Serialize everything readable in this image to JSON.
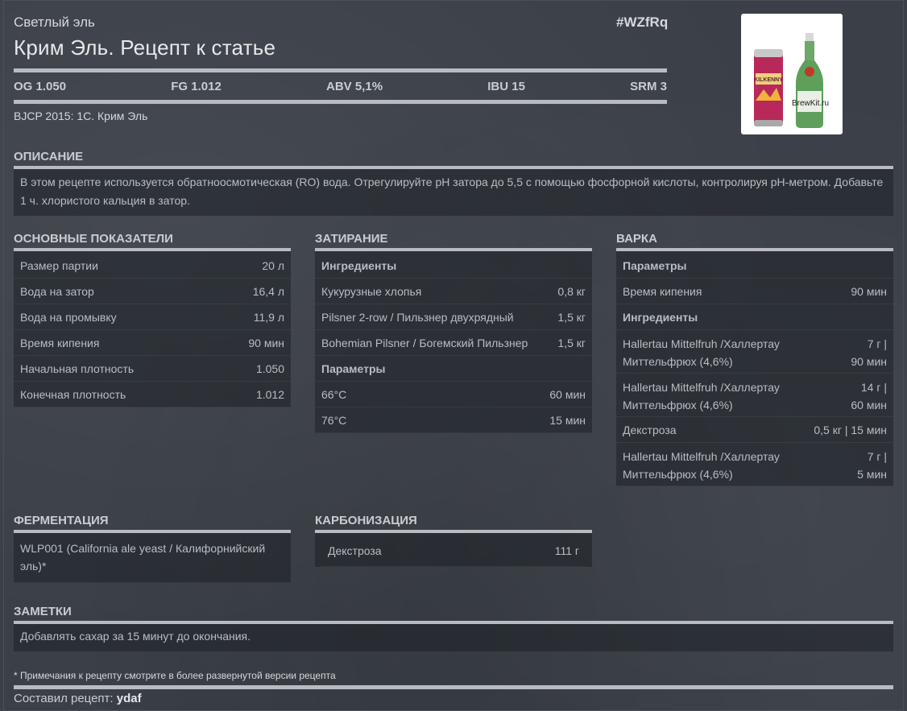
{
  "header": {
    "style_name": "Светлый эль",
    "title": "Крим Эль. Рецепт к статье",
    "code": "#WZfRq",
    "image_watermark": "BrewKit.ru",
    "image_can_text": "KILKENNY"
  },
  "stats": {
    "og": "OG 1.050",
    "fg": "FG 1.012",
    "abv": "ABV 5,1%",
    "ibu": "IBU 15",
    "srm": "SRM 3"
  },
  "bjcp": "BJCP 2015: 1C. Крим Эль",
  "description": {
    "title": "ОПИСАНИЕ",
    "text": "В этом рецепте используется обратноосмотическая (RO) вода. Отрегулируйте pH затора до 5,5 с помощью фосфорной кислоты, контролируя pH-метром. Добавьте 1 ч. хлористого кальция в затор."
  },
  "basics": {
    "title": "ОСНОВНЫЕ ПОКАЗАТЕЛИ",
    "rows": [
      {
        "label": "Размер партии",
        "value": "20 л"
      },
      {
        "label": "Вода на затор",
        "value": "16,4 л"
      },
      {
        "label": "Вода на промывку",
        "value": "11,9 л"
      },
      {
        "label": "Время кипения",
        "value": "90 мин"
      },
      {
        "label": "Начальная плотность",
        "value": "1.050"
      },
      {
        "label": "Конечная плотность",
        "value": "1.012"
      }
    ]
  },
  "mash": {
    "title": "ЗАТИРАНИЕ",
    "ingredients_label": "Ингредиенты",
    "ingredients": [
      {
        "label": "Кукурузные хлопья",
        "value": "0,8 кг"
      },
      {
        "label": "Pilsner 2-row / Пильзнер двухрядный",
        "value": "1,5 кг"
      },
      {
        "label": "Bohemian Pilsner / Богемский Пильзнер",
        "value": "1,5 кг"
      }
    ],
    "params_label": "Параметры",
    "params": [
      {
        "label": "66°C",
        "value": "60 мин"
      },
      {
        "label": "76°C",
        "value": "15 мин"
      }
    ]
  },
  "boil": {
    "title": "ВАРКА",
    "params_label": "Параметры",
    "params": [
      {
        "label": "Время кипения",
        "value": "90 мин"
      }
    ],
    "ingredients_label": "Ингредиенты",
    "ingredients": [
      {
        "line1": "Hallertau Mittelfruh /Халлертау",
        "line2": "Миттельфрюх (4,6%)",
        "value1": "7 г |",
        "value2": "90 мин"
      },
      {
        "line1": "Hallertau Mittelfruh /Халлертау",
        "line2": "Миттельфрюх (4,6%)",
        "value1": "14 г |",
        "value2": "60 мин"
      },
      {
        "label": "Декстроза",
        "value": "0,5 кг | 15 мин"
      },
      {
        "line1": "Hallertau Mittelfruh /Халлертау",
        "line2": "Миттельфрюх (4,6%)",
        "value1": "7 г |",
        "value2": "5 мин"
      }
    ]
  },
  "fermentation": {
    "title": "ФЕРМЕНТАЦИЯ",
    "line1": "WLP001 (California ale yeast / Калифорнийский",
    "line2": "эль)*"
  },
  "carbonation": {
    "title": "КАРБОНИЗАЦИЯ",
    "label": "Декстроза",
    "value": "111 г"
  },
  "notes": {
    "title": "ЗАМЕТКИ",
    "text": "Добавлять сахар за 15 минут до окончания."
  },
  "footer": {
    "note": "* Примечания к рецепту смотрите в более развернутой версии рецепта",
    "author_label": "Составил рецепт:",
    "author": "ydaf"
  }
}
